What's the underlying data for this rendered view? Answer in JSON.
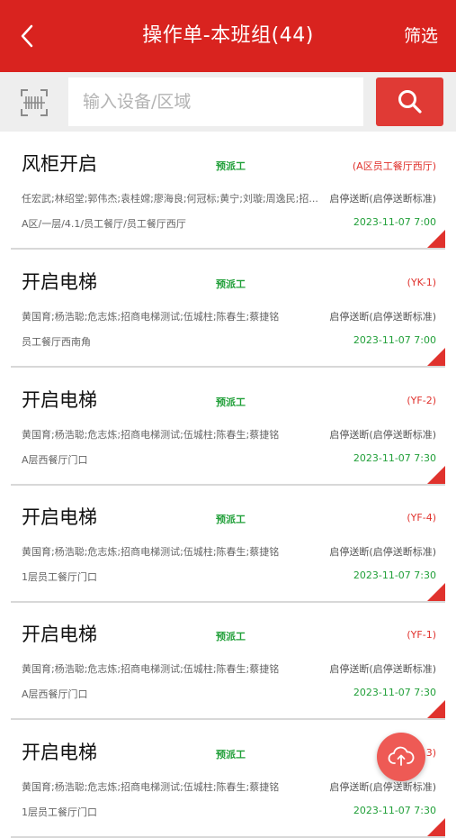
{
  "header": {
    "title": "操作单-本班组(44)",
    "filter_label": "筛选"
  },
  "search": {
    "placeholder": "输入设备/区域",
    "value": ""
  },
  "icons": {
    "back": "back-arrow-icon",
    "scan": "barcode-scan-icon",
    "search": "search-icon",
    "upload": "cloud-upload-icon"
  },
  "colors": {
    "primary": "#d9231f",
    "status_green": "#22a03a",
    "code_red": "#e0322d"
  },
  "orders": [
    {
      "title": "风柜开启",
      "status": "预派工",
      "code": "(A区员工餐厅西厅)",
      "people": "任宏武;林绍堂;郭伟杰;袁桂嫦;廖海良;何冠标;黄宁;刘璇;周逸民;招...",
      "standard": "启停送断(启停送断标准)",
      "location": "A区/一层/4.1/员工餐厅/员工餐厅西厅",
      "time": "2023-11-07 7:00"
    },
    {
      "title": "开启电梯",
      "status": "预派工",
      "code": "(YK-1)",
      "people": "黄国育;杨浩聪;危志炼;招商电梯测试;伍城柱;陈春生;蔡捷铭",
      "standard": "启停送断(启停送断标准)",
      "location": "员工餐厅西南角",
      "time": "2023-11-07 7:00"
    },
    {
      "title": "开启电梯",
      "status": "预派工",
      "code": "(YF-2)",
      "people": "黄国育;杨浩聪;危志炼;招商电梯测试;伍城柱;陈春生;蔡捷铭",
      "standard": "启停送断(启停送断标准)",
      "location": "A层西餐厅门口",
      "time": "2023-11-07 7:30"
    },
    {
      "title": "开启电梯",
      "status": "预派工",
      "code": "(YF-4)",
      "people": "黄国育;杨浩聪;危志炼;招商电梯测试;伍城柱;陈春生;蔡捷铭",
      "standard": "启停送断(启停送断标准)",
      "location": "1层员工餐厅门口",
      "time": "2023-11-07 7:30"
    },
    {
      "title": "开启电梯",
      "status": "预派工",
      "code": "(YF-1)",
      "people": "黄国育;杨浩聪;危志炼;招商电梯测试;伍城柱;陈春生;蔡捷铭",
      "standard": "启停送断(启停送断标准)",
      "location": "A层西餐厅门口",
      "time": "2023-11-07 7:30"
    },
    {
      "title": "开启电梯",
      "status": "预派工",
      "code": "3)",
      "people": "黄国育;杨浩聪;危志炼;招商电梯测试;伍城柱;陈春生;蔡捷铭",
      "standard": "启停送断(启停送断标准)",
      "location": "1层员工餐厅门口",
      "time": "2023-11-07 7:30"
    }
  ]
}
